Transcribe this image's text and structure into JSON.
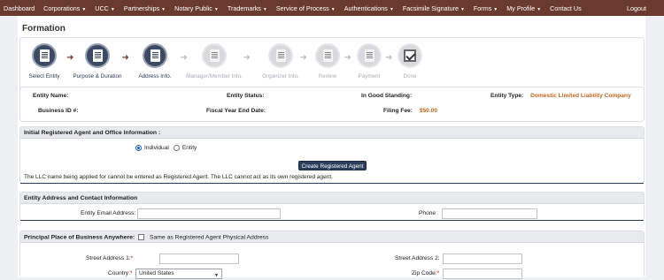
{
  "nav": {
    "items": [
      {
        "label": "Dashboard",
        "dropdown": false
      },
      {
        "label": "Corporations",
        "dropdown": true
      },
      {
        "label": "UCC",
        "dropdown": true
      },
      {
        "label": "Partnerships",
        "dropdown": true
      },
      {
        "label": "Notary Public",
        "dropdown": true
      },
      {
        "label": "Trademarks",
        "dropdown": true
      },
      {
        "label": "Service of Process",
        "dropdown": true
      },
      {
        "label": "Authentications",
        "dropdown": true
      },
      {
        "label": "Facsimile Signature",
        "dropdown": true
      },
      {
        "label": "Forms",
        "dropdown": true
      },
      {
        "label": "My Profile",
        "dropdown": true
      },
      {
        "label": "Contact Us",
        "dropdown": false
      }
    ],
    "logout": "Logout",
    "caret": "▼"
  },
  "page_title": "Formation",
  "steps": [
    {
      "label": "Select Entity",
      "state": "done"
    },
    {
      "label": "Purpose & Duration",
      "state": "done"
    },
    {
      "label": "Address Info.",
      "state": "done"
    },
    {
      "label": "Manager/Member Info.",
      "state": "todo"
    },
    {
      "label": "Organizer Info.",
      "state": "todo"
    },
    {
      "label": "Review",
      "state": "todo"
    },
    {
      "label": "Payment",
      "state": "todo"
    },
    {
      "label": "Done",
      "state": "todo"
    }
  ],
  "summary": {
    "entity_name_label": "Entity Name:",
    "entity_status_label": "Entity Status:",
    "good_standing_label": "In Good Standing:",
    "entity_type_label": "Entity Type:",
    "entity_type_value": "Domestic Limited Liability Company",
    "business_id_label": "Business ID #:",
    "fiscal_year_label": "Fiscal Year End Date:",
    "filing_fee_label": "Filing Fee:",
    "filing_fee_value": "$50.00"
  },
  "registered_agent": {
    "heading": "Initial Registered Agent and Office Information :",
    "option_individual": "Individual",
    "option_entity": "Entity",
    "selected": "Individual",
    "create_button": "Create Registered Agent",
    "note": "The LLC name being applied for cannot be entered as Registered Agent. The LLC cannot act as its own registered agent."
  },
  "entity_address": {
    "heading": "Entity Address and Contact Information",
    "email_label": "Entity Email Address:",
    "email_value": "",
    "phone_label": "Phone:",
    "phone_value": ""
  },
  "principal_place": {
    "heading": "Principal Place of Business Anywhere:",
    "same_as_label": "Same as Registered Agent Physical Address",
    "street1_label": "Street Address 1:",
    "street2_label": "Street Address 2:",
    "country_label": "Country:",
    "country_value": "United States",
    "zip_label": "Zip Code:",
    "required_mark": "*"
  },
  "colors": {
    "nav_bg": "#6b3a2e",
    "accent": "#2c3e5c",
    "fee_orange": "#c0661f"
  }
}
